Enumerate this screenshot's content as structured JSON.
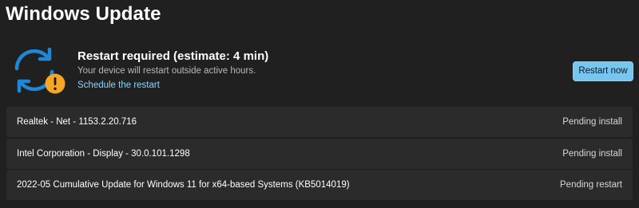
{
  "header": {
    "title": "Windows Update"
  },
  "status": {
    "icon": "sync-warning-icon",
    "title": "Restart required (estimate: 4 min)",
    "subtitle": "Your device will restart outside active hours.",
    "schedule_link": "Schedule the restart",
    "restart_button": "Restart now"
  },
  "colors": {
    "background": "#202020",
    "row_background": "#2b2b2b",
    "accent": "#76c6f0",
    "link": "#8ad4f8",
    "sync_icon_blue": "#1e88d8",
    "warning_badge": "#f5a623"
  },
  "updates": [
    {
      "name": "Realtek - Net - 1153.2.20.716",
      "status": "Pending install"
    },
    {
      "name": "Intel Corporation - Display - 30.0.101.1298",
      "status": "Pending install"
    },
    {
      "name": "2022-05 Cumulative Update for Windows 11 for x64-based Systems (KB5014019)",
      "status": "Pending restart"
    }
  ]
}
